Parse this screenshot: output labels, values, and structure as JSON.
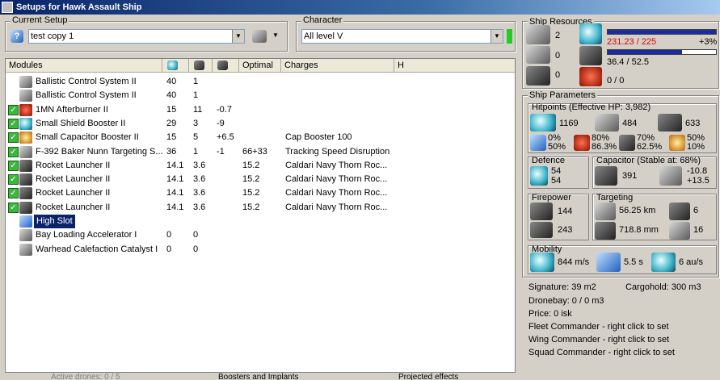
{
  "window": {
    "title": "Setups for Hawk Assault Ship"
  },
  "current_setup": {
    "label": "Current Setup",
    "value": "test copy 1"
  },
  "character": {
    "label": "Character",
    "value": "All level V"
  },
  "modules": {
    "headers": [
      "Modules",
      "",
      "",
      "",
      "Optimal",
      "Charges",
      "H"
    ],
    "rows": [
      {
        "name": "Ballistic Control System II",
        "c1": "40",
        "c2": "1",
        "c3": "",
        "c4": "",
        "c5": "",
        "checked": false,
        "icon": "gray"
      },
      {
        "name": "Ballistic Control System II",
        "c1": "40",
        "c2": "1",
        "c3": "",
        "c4": "",
        "c5": "",
        "checked": false,
        "icon": "gray"
      },
      {
        "name": "1MN Afterburner II",
        "c1": "15",
        "c2": "11",
        "c3": "-0.7",
        "c4": "",
        "c5": "",
        "checked": true,
        "icon": "red"
      },
      {
        "name": "Small Shield Booster II",
        "c1": "29",
        "c2": "3",
        "c3": "-9",
        "c4": "",
        "c5": "",
        "checked": true,
        "icon": "cyan"
      },
      {
        "name": "Small Capacitor Booster II",
        "c1": "15",
        "c2": "5",
        "c3": "+6.5",
        "c4": "",
        "c5": "Cap Booster 100",
        "checked": true,
        "icon": "gold"
      },
      {
        "name": "F-392 Baker Nunn Targeting S...",
        "c1": "36",
        "c2": "1",
        "c3": "-1",
        "c4": "66+33",
        "c5": "Tracking Speed Disruption",
        "checked": true,
        "icon": "gray"
      },
      {
        "name": "Rocket Launcher II",
        "c1": "14.1",
        "c2": "3.6",
        "c3": "",
        "c4": "15.2",
        "c5": "Caldari Navy Thorn Roc...",
        "checked": true,
        "icon": "dark"
      },
      {
        "name": "Rocket Launcher II",
        "c1": "14.1",
        "c2": "3.6",
        "c3": "",
        "c4": "15.2",
        "c5": "Caldari Navy Thorn Roc...",
        "checked": true,
        "icon": "dark"
      },
      {
        "name": "Rocket Launcher II",
        "c1": "14.1",
        "c2": "3.6",
        "c3": "",
        "c4": "15.2",
        "c5": "Caldari Navy Thorn Roc...",
        "checked": true,
        "icon": "dark"
      },
      {
        "name": "Rocket Launcher II",
        "c1": "14.1",
        "c2": "3.6",
        "c3": "",
        "c4": "15.2",
        "c5": "Caldari Navy Thorn Roc...",
        "checked": true,
        "icon": "dark"
      },
      {
        "name": "High Slot",
        "c1": "",
        "c2": "",
        "c3": "",
        "c4": "",
        "c5": "",
        "checked": false,
        "icon": "blue",
        "selected": true
      },
      {
        "name": "Bay Loading Accelerator I",
        "c1": "0",
        "c2": "0",
        "c3": "",
        "c4": "",
        "c5": "",
        "checked": false,
        "icon": "gray"
      },
      {
        "name": "Warhead Calefaction Catalyst I",
        "c1": "0",
        "c2": "0",
        "c3": "",
        "c4": "",
        "c5": "",
        "checked": false,
        "icon": "gray"
      }
    ]
  },
  "bottom": {
    "drones": "Active drones: 0 / 5",
    "boosters": "Boosters and Implants",
    "projected": "Projected effects"
  },
  "resources": {
    "label": "Ship Resources",
    "hardpoints": [
      "2",
      "0",
      "0"
    ],
    "cpu": "231.23 / 225",
    "cpu_bonus": "+3%",
    "cpu_fraction": 1.0,
    "power": "36.4 / 52.5",
    "power_fraction": 0.69,
    "calibration": "0 / 0"
  },
  "params": {
    "label": "Ship Parameters",
    "hitpoints": {
      "label": "Hitpoints (Effective HP: 3,982)",
      "shield": "1169",
      "armor": "484",
      "structure": "633"
    },
    "resists": [
      "0%",
      "50%",
      "80%",
      "86.3%",
      "70%",
      "62.5%",
      "50%",
      "10%"
    ],
    "defence": {
      "label": "Defence",
      "v1": "54",
      "v2": "54",
      "v3": "391",
      "v4": "-10.8",
      "v5": "+13.5"
    },
    "capacitor": {
      "label": "Capacitor (Stable at: 68%)"
    },
    "firepower": {
      "label": "Firepower",
      "dps": "144",
      "volley": "243"
    },
    "targeting": {
      "label": "Targeting",
      "range": "56.25 km",
      "targets": "6",
      "scanres": "718.8 mm",
      "sensor": "16"
    },
    "mobility": {
      "label": "Mobility",
      "speed": "844 m/s",
      "align": "5.5 s",
      "warp": "6 au/s"
    },
    "signature": "Signature: 39 m2",
    "cargohold": "Cargohold: 300 m3",
    "dronebay": "Dronebay: 0 / 0 m3",
    "price": "Price: 0 isk",
    "fleet": "Fleet Commander - right click to set",
    "wing": "Wing Commander - right click to set",
    "squad": "Squad Commander - right click to set"
  }
}
